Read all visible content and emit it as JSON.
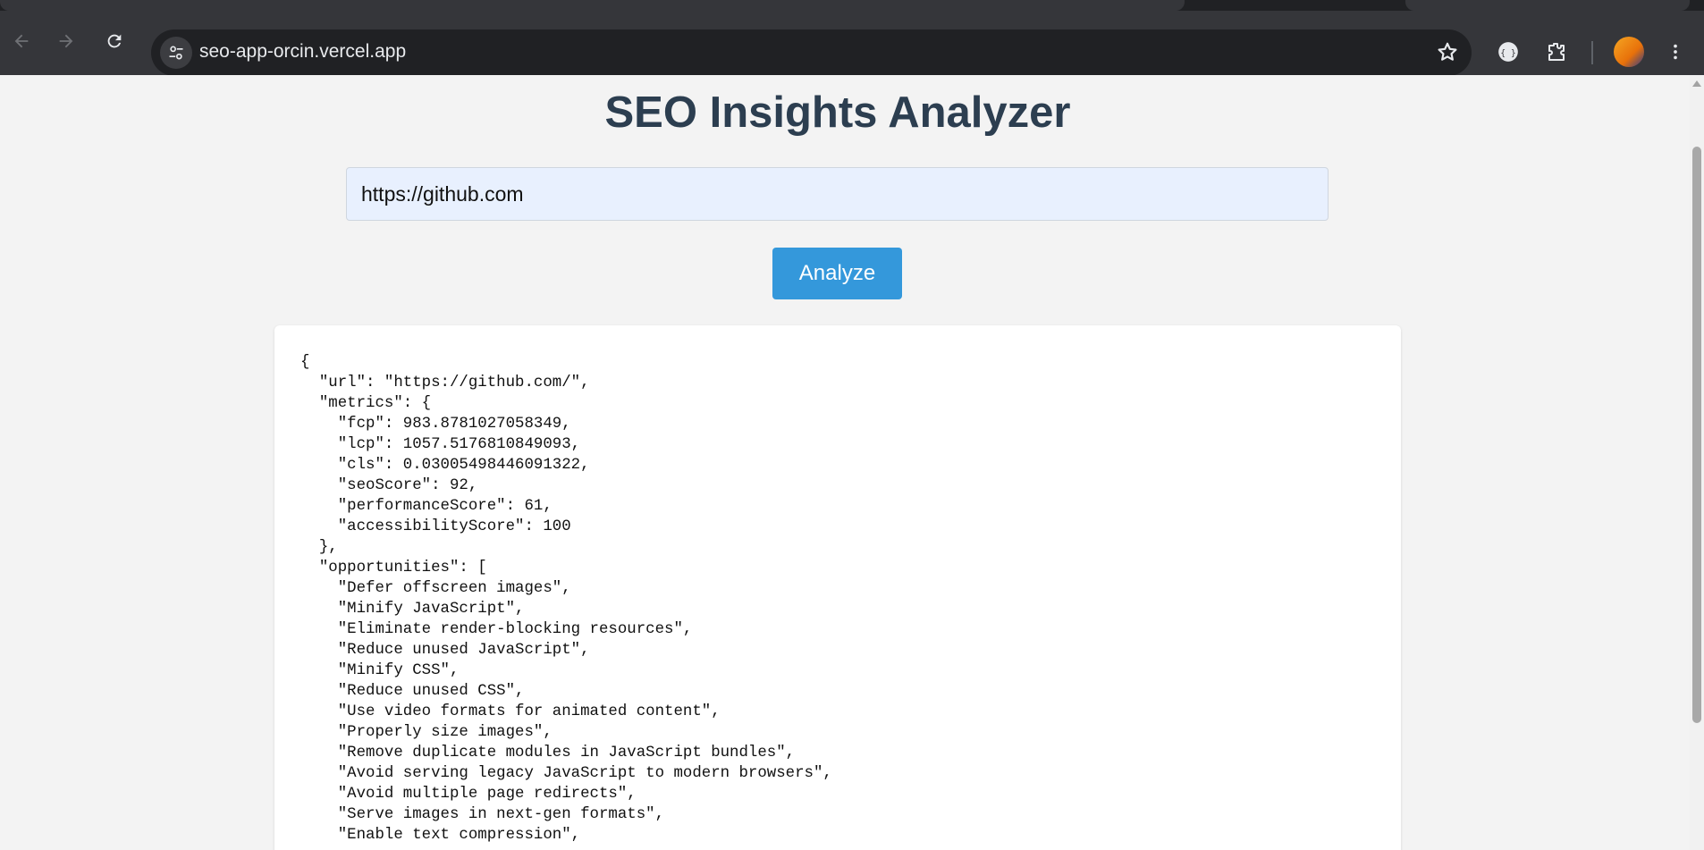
{
  "browser": {
    "url": "seo-app-orcin.vercel.app",
    "icons": {
      "back": "back-arrow-icon",
      "forward": "forward-arrow-icon",
      "reload": "reload-icon",
      "site_info": "tune-icon",
      "bookmark": "star-icon",
      "extension_1": "extension-icon",
      "extensions": "puzzle-icon",
      "menu": "kebab-menu-icon"
    }
  },
  "page": {
    "title": "SEO Insights Analyzer",
    "url_input_value": "https://github.com",
    "analyze_label": "Analyze",
    "result_lines": [
      "{",
      "  \"url\": \"https://github.com/\",",
      "  \"metrics\": {",
      "    \"fcp\": 983.8781027058349,",
      "    \"lcp\": 1057.5176810849093,",
      "    \"cls\": 0.03005498446091322,",
      "    \"seoScore\": 92,",
      "    \"performanceScore\": 61,",
      "    \"accessibilityScore\": 100",
      "  },",
      "  \"opportunities\": [",
      "    \"Defer offscreen images\",",
      "    \"Minify JavaScript\",",
      "    \"Eliminate render-blocking resources\",",
      "    \"Reduce unused JavaScript\",",
      "    \"Minify CSS\",",
      "    \"Reduce unused CSS\",",
      "    \"Use video formats for animated content\",",
      "    \"Properly size images\",",
      "    \"Remove duplicate modules in JavaScript bundles\",",
      "    \"Avoid serving legacy JavaScript to modern browsers\",",
      "    \"Avoid multiple page redirects\",",
      "    \"Serve images in next-gen formats\",",
      "    \"Enable text compression\","
    ]
  },
  "colors": {
    "title": "#2c3e50",
    "button": "#3498db",
    "input_bg": "#e8f0fe",
    "page_bg": "#f3f3f3"
  }
}
